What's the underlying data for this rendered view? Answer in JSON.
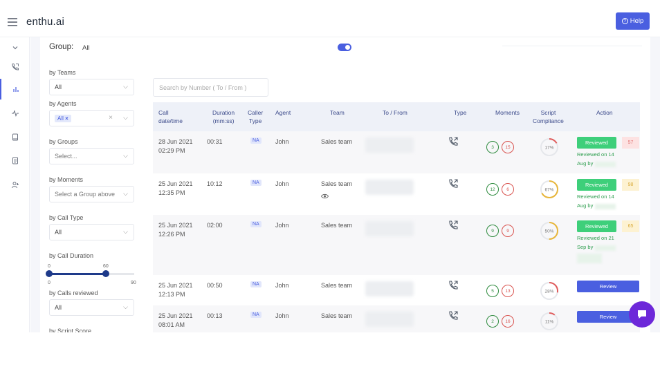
{
  "app": {
    "brand": "enthu.ai",
    "help_label": "Help"
  },
  "rail": {
    "icons": [
      "chevron-down-icon",
      "phone-calls-icon",
      "bar-chart-icon",
      "activity-icon",
      "book-icon",
      "document-icon",
      "add-user-icon"
    ]
  },
  "header": {
    "group_label": "Group:",
    "group_value": "All"
  },
  "filters": {
    "teams": {
      "label": "by Teams",
      "value": "All"
    },
    "agents": {
      "label": "by Agents",
      "chip": "All"
    },
    "groups": {
      "label": "by Groups",
      "placeholder": "Select..."
    },
    "moments": {
      "label": "by Moments",
      "placeholder": "Select a Group above"
    },
    "call_type": {
      "label": "by Call Type",
      "value": "All"
    },
    "call_duration": {
      "label": "by Call Duration",
      "min_selected": "0",
      "max_selected": "60",
      "range_min": "0",
      "range_max": "90"
    },
    "calls_reviewed": {
      "label": "by Calls reviewed",
      "value": "All"
    },
    "script_score": {
      "label": "by Script Score"
    }
  },
  "search": {
    "placeholder": "Search by Number ( To / From )"
  },
  "table": {
    "headers": {
      "call_date": [
        "Call",
        "date/time"
      ],
      "duration": [
        "Duration",
        "(mm:ss)"
      ],
      "caller_type": [
        "Caller",
        "Type"
      ],
      "agent": "Agent",
      "team": "Team",
      "to_from": "To / From",
      "type": "Type",
      "moments": "Moments",
      "script": [
        "Script",
        "Compliance"
      ],
      "action": "Action"
    },
    "rows": [
      {
        "date": "28 Jun 2021",
        "time": "02:29 PM",
        "duration": "00:31",
        "caller_type": "NA",
        "agent": "John",
        "team": "Sales team",
        "moment_pos": "3",
        "moment_neg": "15",
        "score": "17%",
        "score_pct": 17,
        "score_color": "#e05a5a",
        "action": "reviewed",
        "action_label": "Reviewed",
        "reviewed_on": "Reviewed on 14",
        "reviewed_by": "Aug by",
        "badge": "57",
        "badge_color": "red"
      },
      {
        "date": "25 Jun 2021",
        "time": "12:35 PM",
        "duration": "10:12",
        "caller_type": "NA",
        "agent": "John",
        "team": "Sales team",
        "moment_pos": "12",
        "moment_neg": "6",
        "score": "67%",
        "score_pct": 67,
        "score_color": "#e8b63a",
        "action": "reviewed",
        "action_label": "Reviewed",
        "reviewed_on": "Reviewed on 14",
        "reviewed_by": "Aug by",
        "badge": "98",
        "badge_color": "yellow"
      },
      {
        "date": "25 Jun 2021",
        "time": "12:26 PM",
        "duration": "02:00",
        "caller_type": "NA",
        "agent": "John",
        "team": "Sales team",
        "moment_pos": "9",
        "moment_neg": "9",
        "score": "50%",
        "score_pct": 50,
        "score_color": "#e8b63a",
        "action": "reviewed",
        "action_label": "Reviewed",
        "reviewed_on": "Reviewed on 21",
        "reviewed_by": "Sep by",
        "badge": "65",
        "badge_color": "yellow"
      },
      {
        "date": "25 Jun 2021",
        "time": "12:13 PM",
        "duration": "00:50",
        "caller_type": "NA",
        "agent": "John",
        "team": "Sales team",
        "moment_pos": "5",
        "moment_neg": "13",
        "score": "28%",
        "score_pct": 28,
        "score_color": "#e05a5a",
        "action": "review",
        "action_label": "Review"
      },
      {
        "date": "25 Jun 2021",
        "time": "08:01 AM",
        "duration": "00:13",
        "caller_type": "NA",
        "agent": "John",
        "team": "Sales team",
        "moment_pos": "2",
        "moment_neg": "16",
        "score": "11%",
        "score_pct": 11,
        "score_color": "#e05a5a",
        "action": "review",
        "action_label": "Review"
      }
    ]
  },
  "colors": {
    "primary": "#4a5fe0",
    "success": "#3ecf7a",
    "chat": "#6d28d9"
  }
}
